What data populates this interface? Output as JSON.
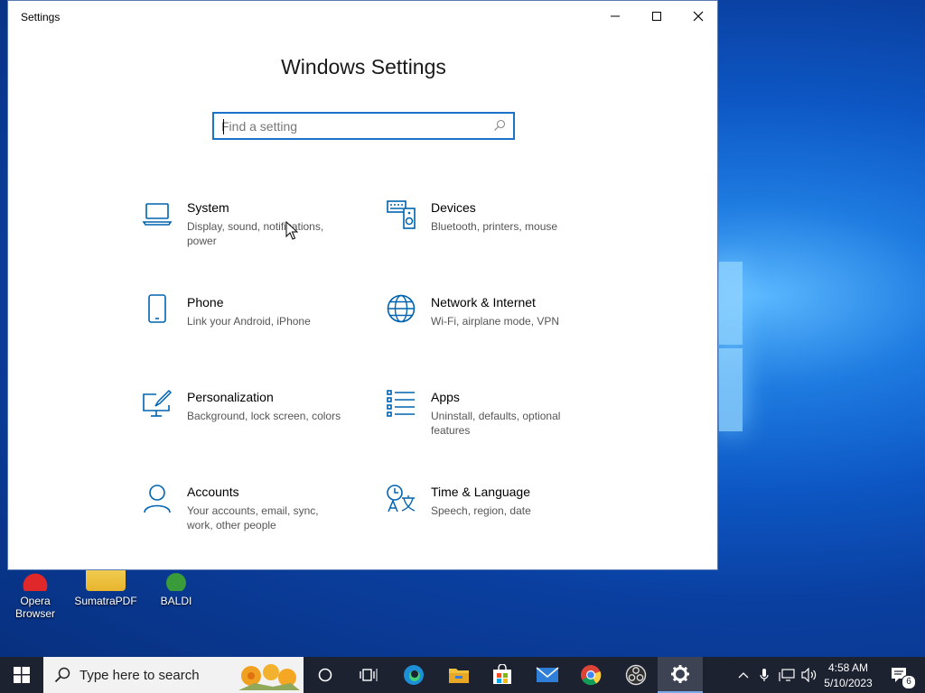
{
  "window": {
    "title": "Settings",
    "heading": "Windows Settings",
    "search": {
      "placeholder": "Find a setting",
      "icon": "search-icon"
    },
    "controls": {
      "minimize": "minimize-icon",
      "maximize": "maximize-icon",
      "close": "close-icon"
    }
  },
  "categories": [
    {
      "name": "System",
      "desc": "Display, sound, notifications, power",
      "icon": "laptop-icon"
    },
    {
      "name": "Devices",
      "desc": "Bluetooth, printers, mouse",
      "icon": "keyboard-speaker-icon"
    },
    {
      "name": "Phone",
      "desc": "Link your Android, iPhone",
      "icon": "phone-icon"
    },
    {
      "name": "Network & Internet",
      "desc": "Wi-Fi, airplane mode, VPN",
      "icon": "globe-icon"
    },
    {
      "name": "Personalization",
      "desc": "Background, lock screen, colors",
      "icon": "paint-monitor-icon"
    },
    {
      "name": "Apps",
      "desc": "Uninstall, defaults, optional features",
      "icon": "apps-list-icon"
    },
    {
      "name": "Accounts",
      "desc": "Your accounts, email, sync, work, other people",
      "icon": "person-icon"
    },
    {
      "name": "Time & Language",
      "desc": "Speech, region, date",
      "icon": "time-language-icon"
    }
  ],
  "desktop": {
    "icons": [
      {
        "label": "Opera Browser"
      },
      {
        "label": "SumatraPDF"
      },
      {
        "label": "BALDI"
      }
    ]
  },
  "taskbar": {
    "search_text": "Type here to search",
    "apps": [
      "cortana-icon",
      "task-view-icon",
      "edge-icon",
      "file-explorer-icon",
      "store-icon",
      "mail-icon",
      "chrome-icon",
      "obs-icon",
      "settings-icon"
    ],
    "clock_time": "4:58 AM",
    "clock_date": "5/10/2023",
    "notification_count": "6"
  },
  "colors": {
    "accent": "#0063b1",
    "taskbar": "#1c2230"
  }
}
